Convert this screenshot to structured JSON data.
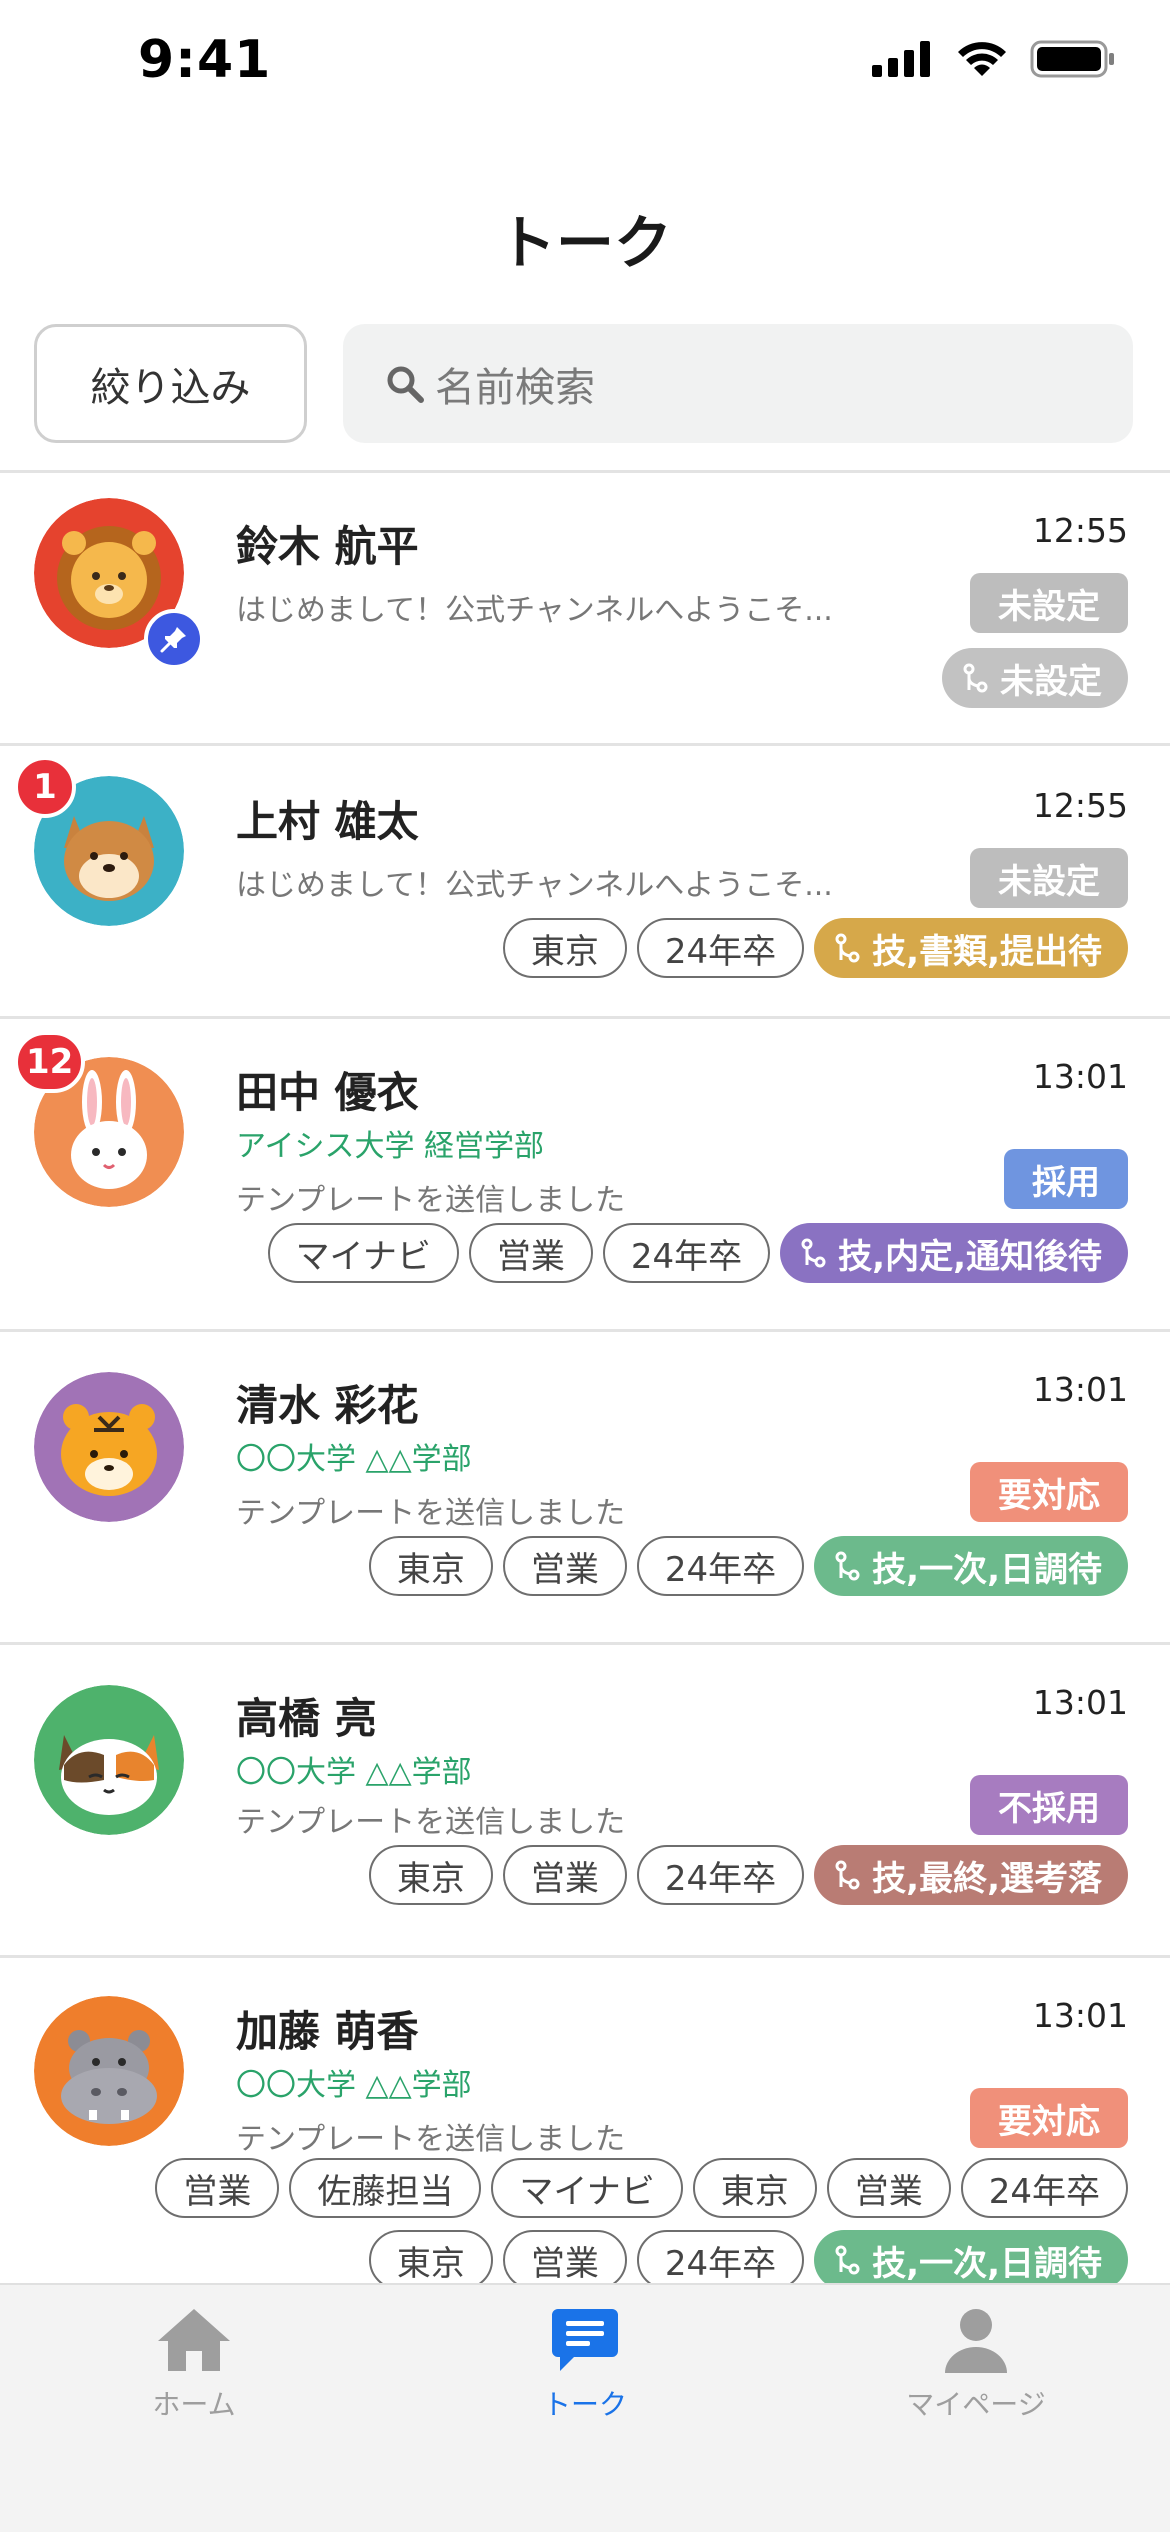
{
  "status_bar": {
    "time": "9:41"
  },
  "header": {
    "title": "トーク",
    "filter_label": "絞り込み",
    "search_placeholder": "名前検索"
  },
  "colors": {
    "accent": "#1a73e8",
    "school_green": "#2aa36a",
    "badge_red": "#e8303a"
  },
  "conversations": [
    {
      "name": "鈴木 航平",
      "time": "12:55",
      "school": "",
      "message": "はじめまして！公式チャンネルへようこそ...",
      "status": "未設定",
      "status_color": "#bdbdbd",
      "tags": [],
      "stage": "未設定",
      "stage_color": "#c2c2c2",
      "unread": "",
      "pinned": true,
      "avatar": "lion"
    },
    {
      "name": "上村 雄太",
      "time": "12:55",
      "school": "",
      "message": "はじめまして！公式チャンネルへようこそ...",
      "status": "未設定",
      "status_color": "#bdbdbd",
      "tags": [
        "東京",
        "24年卒"
      ],
      "stage": "技,書類,提出待",
      "stage_color": "#d6a84a",
      "unread": "1",
      "pinned": false,
      "avatar": "shiba"
    },
    {
      "name": "田中 優衣",
      "time": "13:01",
      "school": "アイシス大学 経営学部",
      "message": "テンプレートを送信しました",
      "status": "採用",
      "status_color": "#6f95e0",
      "tags": [
        "マイナビ",
        "営業",
        "24年卒"
      ],
      "stage": "技,内定,通知後待",
      "stage_color": "#8a72c2",
      "unread": "12",
      "pinned": false,
      "avatar": "rabbit"
    },
    {
      "name": "清水 彩花",
      "time": "13:01",
      "school": "〇〇大学 △△学部",
      "message": "テンプレートを送信しました",
      "status": "要対応",
      "status_color": "#f0907a",
      "tags": [
        "東京",
        "営業",
        "24年卒"
      ],
      "stage": "技,一次,日調待",
      "stage_color": "#6cba8c",
      "unread": "",
      "pinned": false,
      "avatar": "tiger"
    },
    {
      "name": "高橋 亮",
      "time": "13:01",
      "school": "〇〇大学 △△学部",
      "message": "テンプレートを送信しました",
      "status": "不採用",
      "status_color": "#a77cc0",
      "tags": [
        "東京",
        "営業",
        "24年卒"
      ],
      "stage": "技,最終,選考落",
      "stage_color": "#b97c74",
      "unread": "",
      "pinned": false,
      "avatar": "cat"
    },
    {
      "name": "加藤 萌香",
      "time": "13:01",
      "school": "〇〇大学 △△学部",
      "message": "テンプレートを送信しました",
      "status": "要対応",
      "status_color": "#f0907a",
      "tags": [
        "営業",
        "佐藤担当",
        "マイナビ",
        "東京",
        "営業",
        "24年卒"
      ],
      "tags2": [
        "東京",
        "営業",
        "24年卒"
      ],
      "stage": "技,一次,日調待",
      "stage_color": "#6cba8c",
      "unread": "",
      "pinned": false,
      "avatar": "hippo"
    }
  ],
  "tabbar": {
    "home": "ホーム",
    "talk": "トーク",
    "mypage": "マイページ"
  }
}
